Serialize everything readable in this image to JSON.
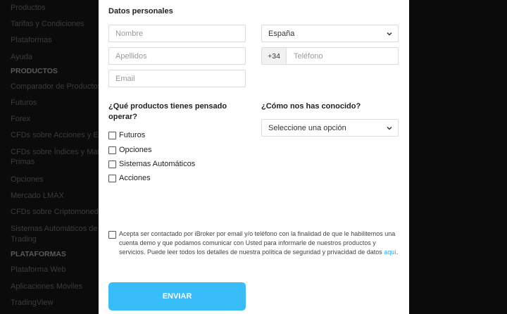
{
  "sidebar": {
    "items": [
      {
        "label": "Productos",
        "heading": false
      },
      {
        "label": "Tarifas y Condiciones",
        "heading": false
      },
      {
        "label": "Plataformas",
        "heading": false
      },
      {
        "label": "Ayuda",
        "heading": false
      },
      {
        "label": "PRODUCTOS",
        "heading": true
      },
      {
        "label": "Comparador de Productos",
        "heading": false
      },
      {
        "label": "Futuros",
        "heading": false
      },
      {
        "label": "Forex",
        "heading": false
      },
      {
        "label": "CFDs sobre Acciones y ETFs",
        "heading": false
      },
      {
        "label": "CFDs sobre Índices y Materias",
        "heading": false
      },
      {
        "label": "Primas",
        "heading": false
      },
      {
        "label": "Opciones",
        "heading": false
      },
      {
        "label": "Mercado LMAX",
        "heading": false
      },
      {
        "label": "CFDs sobre Criptomonedas",
        "heading": false
      },
      {
        "label": "Sistemas Automáticos de",
        "heading": false
      },
      {
        "label": "Trading",
        "heading": false
      },
      {
        "label": "PLATAFORMAS",
        "heading": true
      },
      {
        "label": "Plataforma Web",
        "heading": false
      },
      {
        "label": "Aplicaciones Móviles",
        "heading": false
      },
      {
        "label": "TradingView",
        "heading": false
      }
    ]
  },
  "form": {
    "section_title": "Datos personales",
    "name_placeholder": "Nombre",
    "surname_placeholder": "Apellidos",
    "email_placeholder": "Email",
    "country_value": "España",
    "phone_prefix": "+34",
    "phone_placeholder": "Teléfono",
    "products_question": "¿Qué productos tienes pensado operar?",
    "products": [
      "Futuros",
      "Opciones",
      "Sistemas Automáticos",
      "Acciones"
    ],
    "source_question": "¿Cómo nos has conocido?",
    "source_value": "Seleccione una opción",
    "consent_text": "Acepta ser contactado por iBroker por email y/o teléfono con la finalidad de que le habilitemos una cuenta demo y que podamos comunicar con Usted para informarle de nuestros productos y servicios. Puede leer todos los detalles de nuestra política de seguridad y privacidad de datos ",
    "consent_link": "aquí",
    "consent_end": ".",
    "submit_label": "ENVIAR"
  },
  "colors": {
    "accent": "#38bdf8",
    "link": "#2aa9f0",
    "overlay": "#0b0b0b"
  }
}
